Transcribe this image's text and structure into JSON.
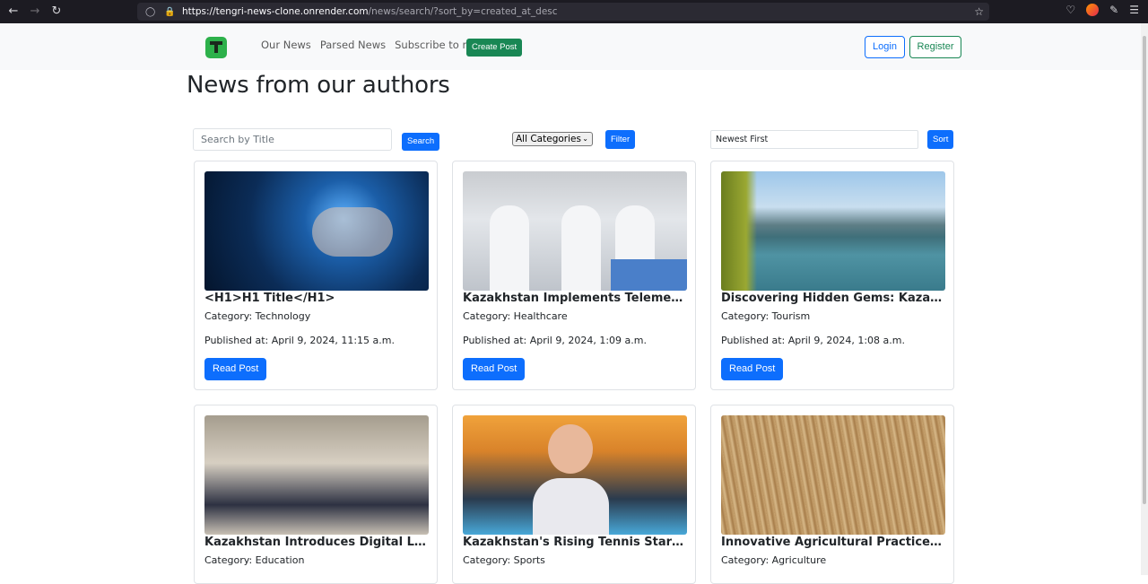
{
  "browser": {
    "url_host": "https://tengri-news-clone.onrender.com",
    "url_path": "/news/search/?sort_by=created_at_desc"
  },
  "nav": {
    "links": [
      "Our News",
      "Parsed News",
      "Subscribe to news"
    ],
    "create_post": "Create Post",
    "login": "Login",
    "register": "Register"
  },
  "page": {
    "title": "News from our authors"
  },
  "filters": {
    "search_placeholder": "Search by Title",
    "search_button": "Search",
    "category_selected": "All Categories",
    "filter_button": "Filter",
    "sort_value": "Newest First",
    "sort_button": "Sort"
  },
  "cards": [
    {
      "title": "<H1>H1 Title</H1>",
      "category": "Category: Technology",
      "published": "Published at: April 9, 2024, 11:15 a.m.",
      "button": "Read Post"
    },
    {
      "title": "Kazakhstan Implements Telemedicine Services",
      "category": "Category: Healthcare",
      "published": "Published at: April 9, 2024, 1:09 a.m.",
      "button": "Read Post"
    },
    {
      "title": "Discovering Hidden Gems: Kazakhstan's Tourism",
      "category": "Category: Tourism",
      "published": "Published at: April 9, 2024, 1:08 a.m.",
      "button": "Read Post"
    },
    {
      "title": "Kazakhstan Introduces Digital Learning Platforms",
      "category": "Category: Education",
      "published": "",
      "button": ""
    },
    {
      "title": "Kazakhstan's Rising Tennis Star Secures Title",
      "category": "Category: Sports",
      "published": "",
      "button": ""
    },
    {
      "title": "Innovative Agricultural Practices Boost Yields",
      "category": "Category: Agriculture",
      "published": "",
      "button": ""
    }
  ]
}
